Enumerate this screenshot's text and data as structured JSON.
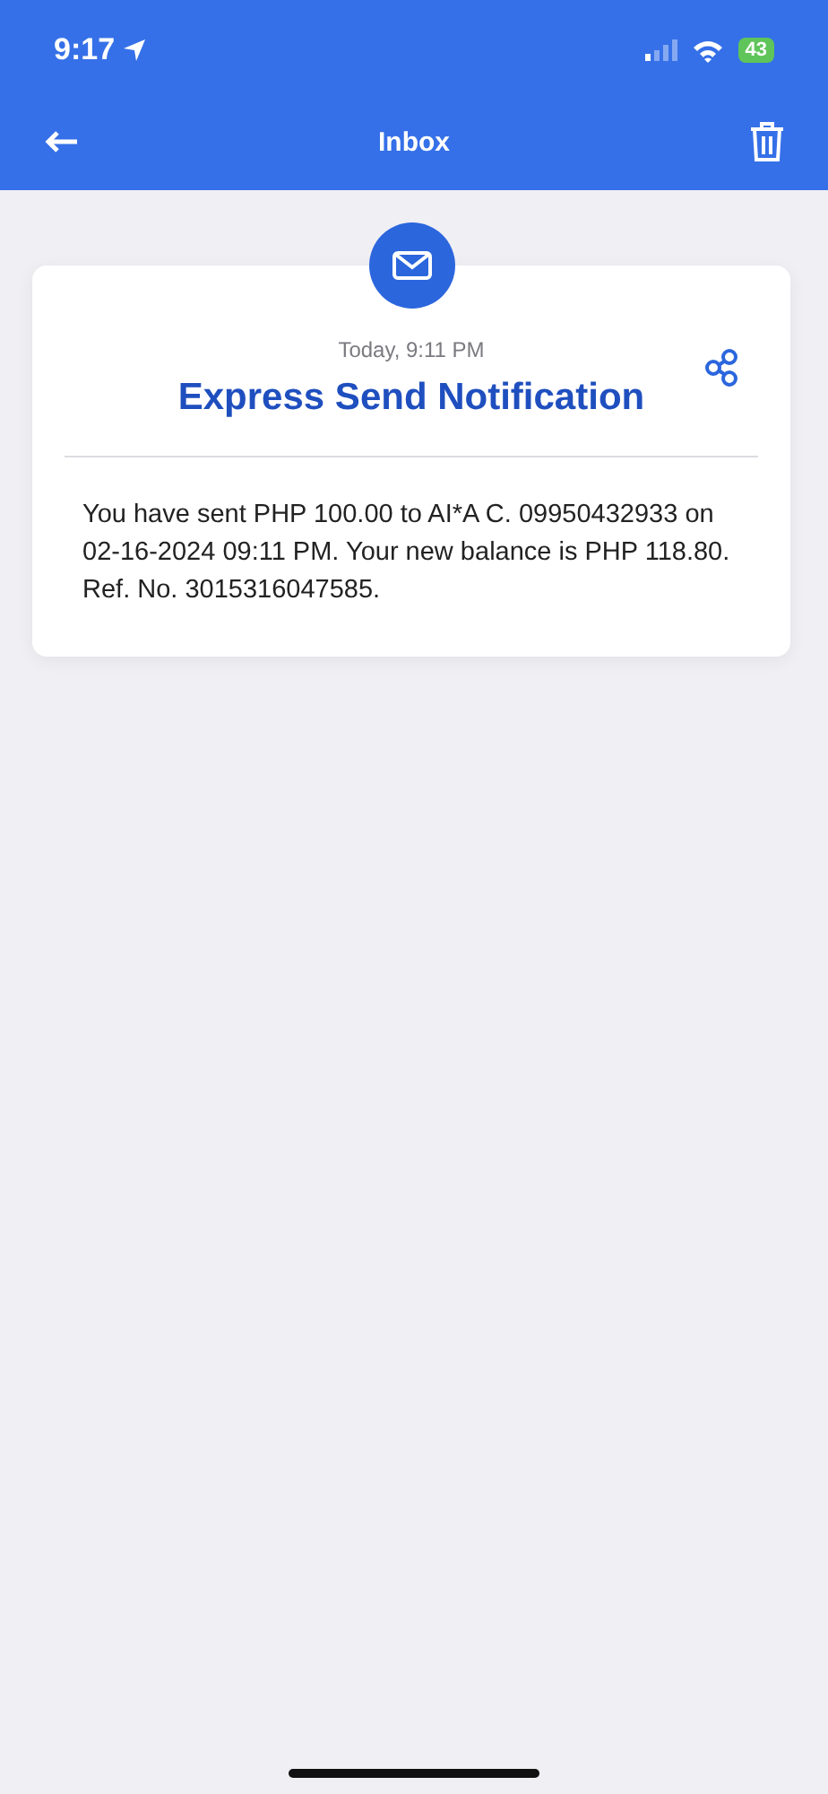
{
  "status_bar": {
    "time": "9:17",
    "battery": "43"
  },
  "nav_bar": {
    "title": "Inbox"
  },
  "message": {
    "date": "Today, 9:11 PM",
    "title": "Express Send Notification",
    "body": "You have sent PHP 100.00 to AI*A C. 09950432933 on 02-16-2024 09:11 PM. Your new balance is PHP 118.80. Ref. No. 3015316047585."
  }
}
